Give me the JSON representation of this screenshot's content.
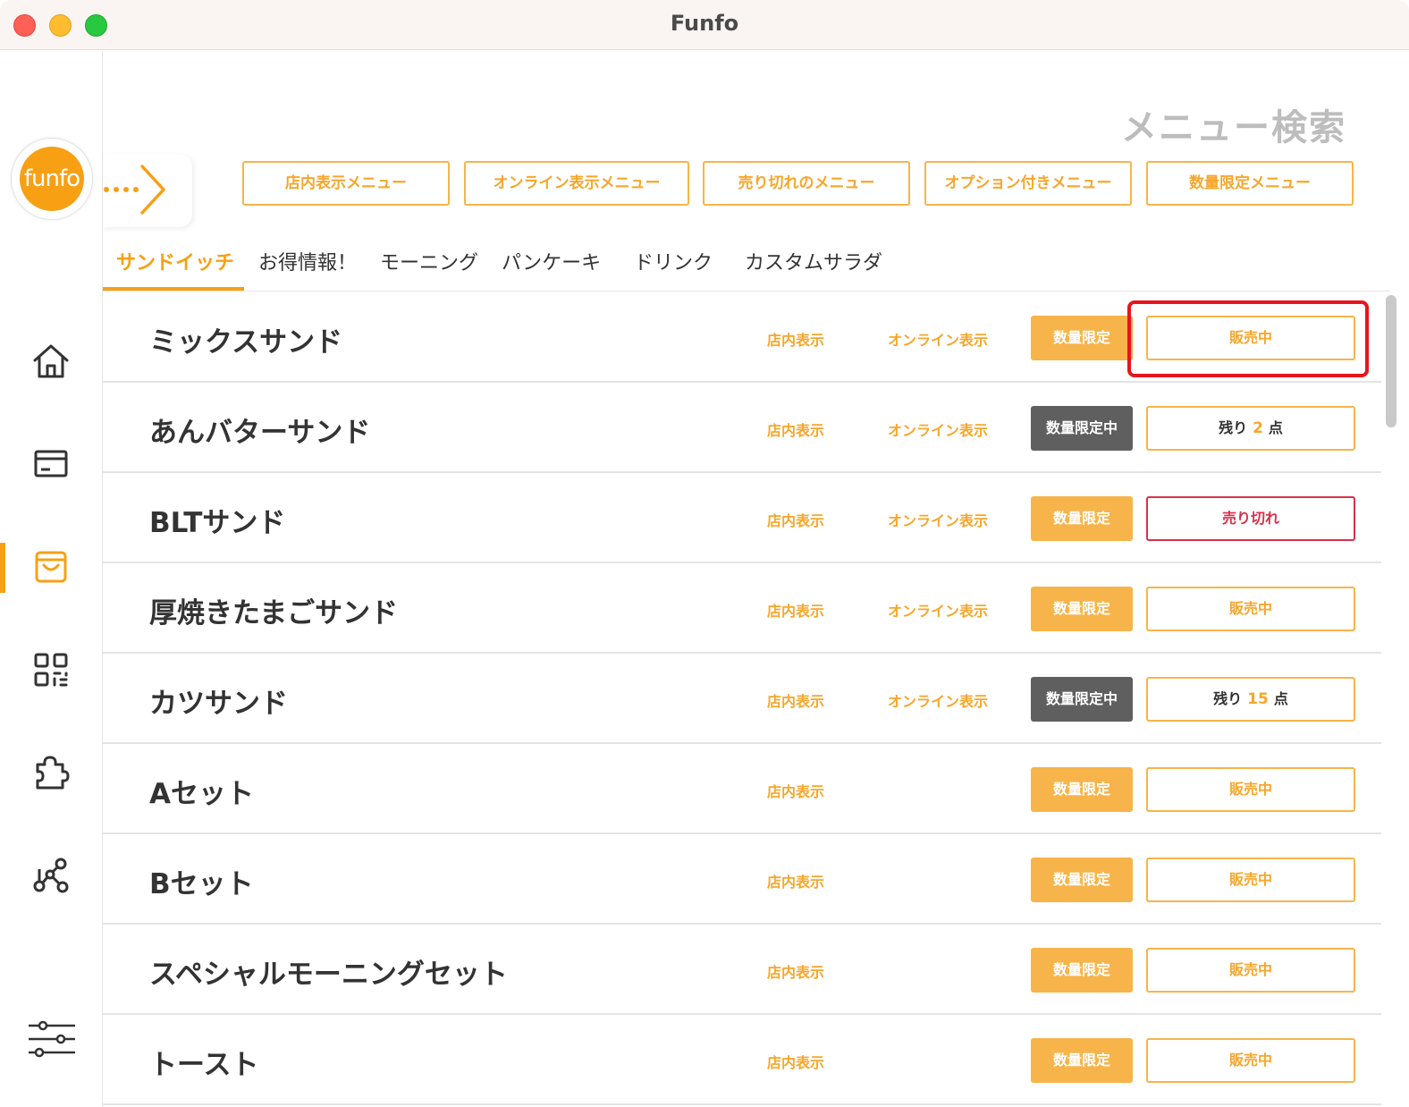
{
  "window": {
    "title": "Funfo"
  },
  "logo": {
    "text": "funfo"
  },
  "sidebar": {
    "items": [
      {
        "name": "home",
        "icon": "home-icon"
      },
      {
        "name": "orders",
        "icon": "card-icon"
      },
      {
        "name": "menu",
        "icon": "shopping-bag-icon",
        "active": true
      },
      {
        "name": "qr",
        "icon": "qr-code-icon"
      },
      {
        "name": "options",
        "icon": "puzzle-icon"
      },
      {
        "name": "network",
        "icon": "network-icon"
      },
      {
        "name": "settings",
        "icon": "sliders-icon"
      }
    ]
  },
  "header": {
    "title": "メニュー検索"
  },
  "filters": [
    {
      "label": "店内表示メニュー"
    },
    {
      "label": "オンライン表示メニュー"
    },
    {
      "label": "売り切れのメニュー"
    },
    {
      "label": "オプション付きメニュー"
    },
    {
      "label": "数量限定メニュー"
    }
  ],
  "tabs": [
    {
      "label": "サンドイッチ",
      "active": true
    },
    {
      "label": "お得情報！"
    },
    {
      "label": "モーニング"
    },
    {
      "label": "パンケーキ"
    },
    {
      "label": "ドリンク"
    },
    {
      "label": "カスタムサラダ"
    }
  ],
  "labels": {
    "store": "店内表示",
    "online": "オンライン表示",
    "limit": "数量限定",
    "limit_on": "数量限定中",
    "selling": "販売中",
    "soldout": "売り切れ",
    "remaining_prefix": "残り",
    "remaining_suffix": "点"
  },
  "items": [
    {
      "name": "ミックスサンド",
      "online": true,
      "limit_on": false,
      "status": "selling"
    },
    {
      "name": "あんバターサンド",
      "online": true,
      "limit_on": true,
      "status": "remaining",
      "remaining": "2"
    },
    {
      "name": "BLTサンド",
      "online": true,
      "limit_on": false,
      "status": "soldout"
    },
    {
      "name": "厚焼きたまごサンド",
      "online": true,
      "limit_on": false,
      "status": "selling"
    },
    {
      "name": "カツサンド",
      "online": true,
      "limit_on": true,
      "status": "remaining",
      "remaining": "15"
    },
    {
      "name": "Aセット",
      "online": false,
      "limit_on": false,
      "status": "selling"
    },
    {
      "name": "Bセット",
      "online": false,
      "limit_on": false,
      "status": "selling"
    },
    {
      "name": "スペシャルモーニングセット",
      "online": false,
      "limit_on": false,
      "status": "selling"
    },
    {
      "name": "トースト",
      "online": false,
      "limit_on": false,
      "status": "selling"
    }
  ],
  "colors": {
    "accent": "#f7a014",
    "soldout": "#d6324a",
    "limit_on": "#5f5f5f",
    "highlight": "#e8141c"
  }
}
